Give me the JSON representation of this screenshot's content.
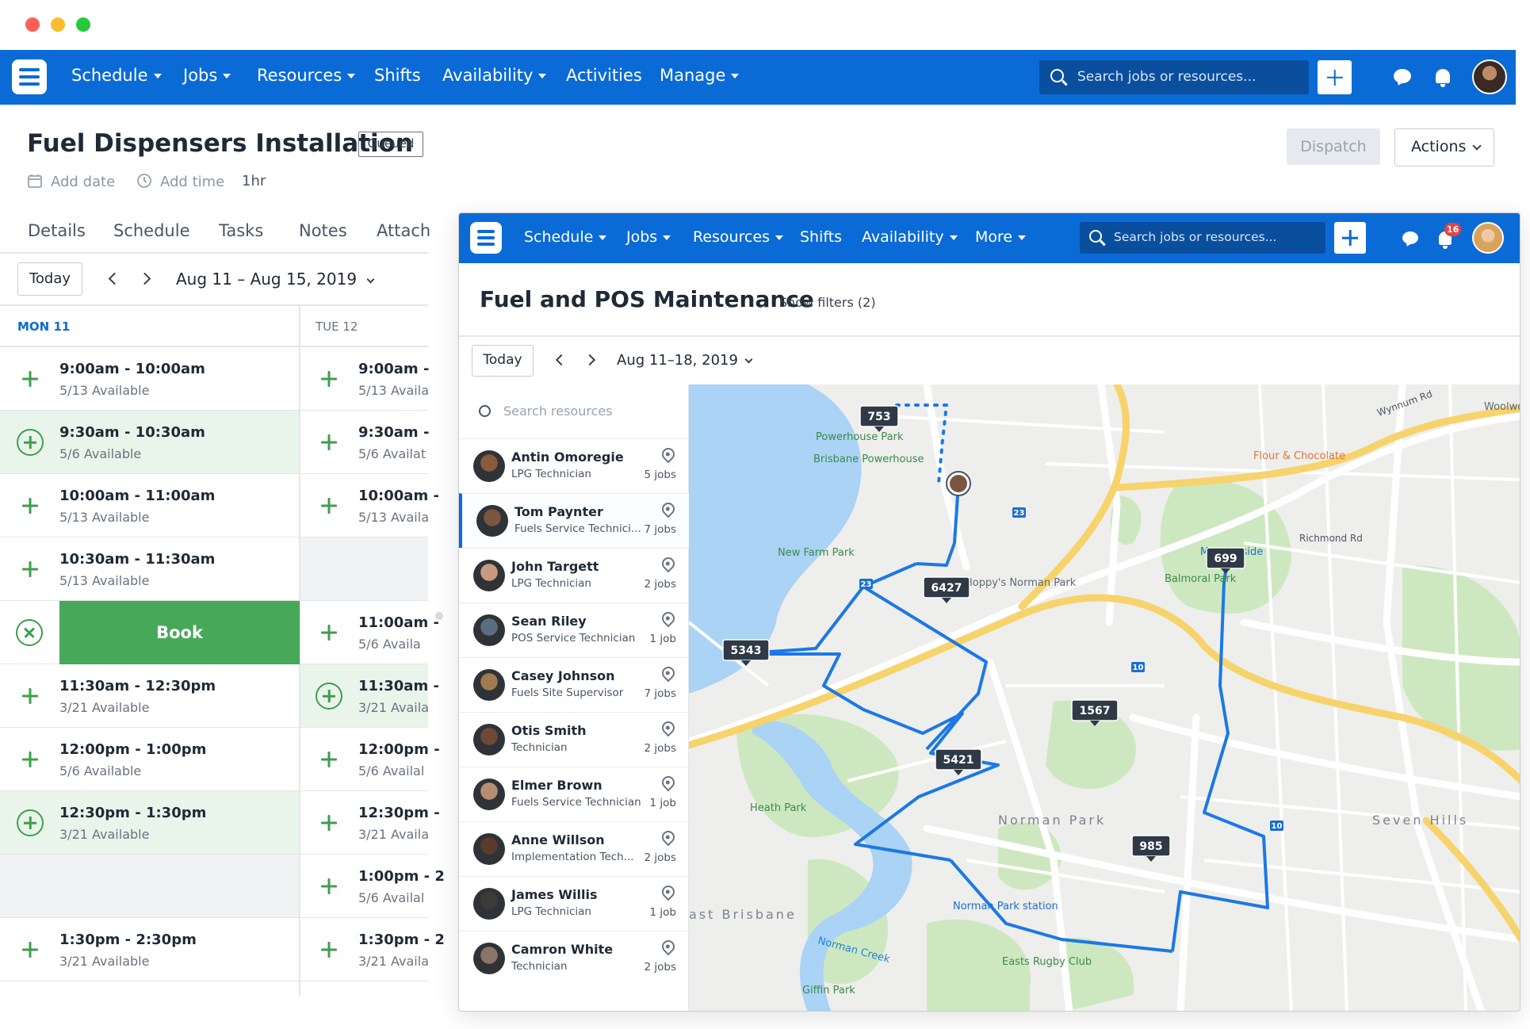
{
  "back_window": {
    "nav": {
      "items": [
        {
          "label": "Schedule",
          "dropdown": true
        },
        {
          "label": "Jobs",
          "dropdown": true
        },
        {
          "label": "Resources",
          "dropdown": true
        },
        {
          "label": "Shifts",
          "dropdown": false
        },
        {
          "label": "Availability",
          "dropdown": true
        },
        {
          "label": "Activities",
          "dropdown": false
        },
        {
          "label": "Manage",
          "dropdown": true
        }
      ],
      "search_placeholder": "Search jobs or resources..."
    },
    "job": {
      "title": "Fuel Dispensers Installation",
      "status": "Queued",
      "add_date": "Add date",
      "add_time": "Add time",
      "duration": "1hr",
      "dispatch_label": "Dispatch",
      "actions_label": "Actions"
    },
    "tabs": [
      "Details",
      "Schedule",
      "Tasks",
      "Notes",
      "Attach"
    ],
    "calendar": {
      "today_label": "Today",
      "range": "Aug 11 – Aug 15, 2019",
      "days": [
        {
          "label": "MON 11",
          "color": "#0b6bd6"
        },
        {
          "label": "TUE 12",
          "color": "#6b7280"
        }
      ],
      "mon_slots": [
        {
          "time": "9:00am - 10:00am",
          "avail": "5/13 Available",
          "state": "normal"
        },
        {
          "time": "9:30am - 10:30am",
          "avail": "5/6 Available",
          "state": "highlight"
        },
        {
          "time": "10:00am - 11:00am",
          "avail": "5/13 Available",
          "state": "normal"
        },
        {
          "time": "10:30am - 11:30am",
          "avail": "5/13 Available",
          "state": "normal"
        },
        {
          "time": "",
          "avail": "",
          "state": "book",
          "book_label": "Book"
        },
        {
          "time": "11:30am - 12:30pm",
          "avail": "3/21 Available",
          "state": "normal"
        },
        {
          "time": "12:00pm - 1:00pm",
          "avail": "5/6 Available",
          "state": "normal"
        },
        {
          "time": "12:30pm - 1:30pm",
          "avail": "3/21 Available",
          "state": "highlight"
        },
        {
          "time": "",
          "avail": "",
          "state": "gray"
        },
        {
          "time": "1:30pm - 2:30pm",
          "avail": "3/21 Available",
          "state": "normal"
        }
      ],
      "tue_slots": [
        {
          "time": "9:00am -",
          "avail": "5/13 Availa",
          "state": "normal"
        },
        {
          "time": "9:30am -",
          "avail": "5/6 Availat",
          "state": "normal"
        },
        {
          "time": "10:00am -",
          "avail": "5/13 Availa",
          "state": "normal"
        },
        {
          "time": "",
          "avail": "",
          "state": "gray"
        },
        {
          "time": "11:00am -",
          "avail": "5/6 Availa",
          "state": "normal"
        },
        {
          "time": "11:30am -",
          "avail": "3/21 Availa",
          "state": "highlight"
        },
        {
          "time": "12:00pm -",
          "avail": "5/6 Availal",
          "state": "normal"
        },
        {
          "time": "12:30pm -",
          "avail": "3/21 Availa",
          "state": "normal"
        },
        {
          "time": "1:00pm - 2",
          "avail": "5/6 Availal",
          "state": "normal"
        },
        {
          "time": "1:30pm - 2",
          "avail": "3/21 Availa",
          "state": "normal"
        }
      ]
    }
  },
  "front_window": {
    "nav": {
      "items": [
        {
          "label": "Schedule",
          "dropdown": true
        },
        {
          "label": "Jobs",
          "dropdown": true
        },
        {
          "label": "Resources",
          "dropdown": true
        },
        {
          "label": "Shifts",
          "dropdown": false
        },
        {
          "label": "Availability",
          "dropdown": true
        },
        {
          "label": "More",
          "dropdown": true
        }
      ],
      "search_placeholder": "Search jobs or resources...",
      "notification_count": "16"
    },
    "title": "Fuel and POS Maintenance",
    "show_filters": "Show filters (2)",
    "today_label": "Today",
    "range": "Aug 11–18, 2019",
    "resource_search_placeholder": "Search resources",
    "resources": [
      {
        "name": "Antin Omoregie",
        "role": "LPG Technician",
        "jobs": "5 jobs",
        "active": false,
        "skin": "#8a5a3c"
      },
      {
        "name": "Tom Paynter",
        "role": "Fuels Service Technici...",
        "jobs": "7 jobs",
        "active": true,
        "skin": "#7a5540"
      },
      {
        "name": "John Targett",
        "role": "LPG Technician",
        "jobs": "2 jobs",
        "active": false,
        "skin": "#c79a7f"
      },
      {
        "name": "Sean Riley",
        "role": "POS Service Technician",
        "jobs": "1 job",
        "active": false,
        "skin": "#5b6d80"
      },
      {
        "name": "Casey Johnson",
        "role": "Fuels Site Supervisor",
        "jobs": "7 jobs",
        "active": false,
        "skin": "#a07a50"
      },
      {
        "name": "Otis Smith",
        "role": "Technician",
        "jobs": "2 jobs",
        "active": false,
        "skin": "#6e4a36"
      },
      {
        "name": "Elmer Brown",
        "role": "Fuels Service Technician",
        "jobs": "1 job",
        "active": false,
        "skin": "#b58e72"
      },
      {
        "name": "Anne Willson",
        "role": "Implementation Tech...",
        "jobs": "2 jobs",
        "active": false,
        "skin": "#5a3a2c"
      },
      {
        "name": "James Willis",
        "role": "LPG Technician",
        "jobs": "1 job",
        "active": false,
        "skin": "#3d3a3a"
      },
      {
        "name": "Camron White",
        "role": "Technician",
        "jobs": "2 jobs",
        "active": false,
        "skin": "#8c7466"
      }
    ],
    "map": {
      "job_markers": [
        "753",
        "6427",
        "5343",
        "699",
        "1567",
        "5421",
        "985"
      ],
      "places": [
        "Powerhouse Park",
        "Brisbane Powerhouse",
        "New Farm Park",
        "Hoppy's Norman Park",
        "Heath Park",
        "Norman Park",
        "Norman Park station",
        "Easts Rugby Club",
        "Giffin Park",
        "Balmoral Park",
        "Morningside",
        "Seven Hills",
        "Flour & Chocolate",
        "Woolwo",
        "Norman Creek",
        "ast Brisbane",
        "Richmond Rd",
        "Wynnum Rd"
      ],
      "road_badges": [
        "23",
        "23",
        "10",
        "10"
      ]
    }
  }
}
